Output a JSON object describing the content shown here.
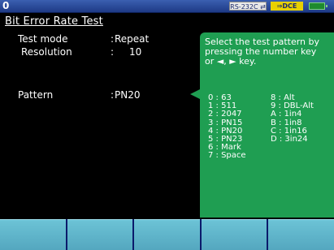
{
  "status": {
    "position_label": "0",
    "interface_badge": "RS-232C",
    "mode_badge": "DCE",
    "battery_icon": "battery-icon"
  },
  "screen_title": "Bit Error Rate Test",
  "settings": {
    "test_mode": {
      "label": "Test mode",
      "sep": ":",
      "value": "Repeat"
    },
    "resolution": {
      "label": "Resolution",
      "sep": ":",
      "value": "10"
    },
    "pattern": {
      "label": "Pattern",
      "sep": ":",
      "value": "PN20"
    }
  },
  "help": {
    "text": "Select the test pattern by pressing the number key or ◄, ► key.",
    "options_left": [
      "0 : 63",
      "1 : 511",
      "2 : 2047",
      "3 : PN15",
      "4 : PN20",
      "5 : PN23",
      "6 : Mark",
      "7 : Space"
    ],
    "options_right": [
      "8 : Alt",
      "9 : DBL-Alt",
      "A : 1in4",
      "B : 1in8",
      "C : 1in16",
      "D : 3in24"
    ]
  },
  "function_keys": [
    "",
    "",
    "",
    "",
    ""
  ],
  "colors": {
    "background": "#000000",
    "panel": "#1f9e52",
    "statusbar": "#1e3a86",
    "function_key": "#5bb4ca"
  }
}
